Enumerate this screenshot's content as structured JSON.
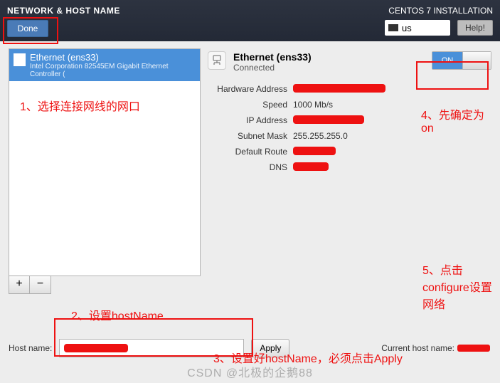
{
  "header": {
    "title": "NETWORK & HOST NAME",
    "done_label": "Done",
    "installer_title": "CENTOS 7 INSTALLATION",
    "keyboard_layout": "us",
    "help_label": "Help!"
  },
  "nic_list": {
    "items": [
      {
        "title": "Ethernet (ens33)",
        "subtitle": "Intel Corporation 82545EM Gigabit Ethernet Controller ("
      }
    ],
    "add_label": "+",
    "remove_label": "−"
  },
  "details": {
    "title": "Ethernet (ens33)",
    "status": "Connected",
    "rows": [
      {
        "label": "Hardware Address",
        "value": ""
      },
      {
        "label": "Speed",
        "value": "1000 Mb/s"
      },
      {
        "label": "IP Address",
        "value": ""
      },
      {
        "label": "Subnet Mask",
        "value": "255.255.255.0"
      },
      {
        "label": "Default Route",
        "value": ""
      },
      {
        "label": "DNS",
        "value": ""
      }
    ]
  },
  "toggle": {
    "on_label": "ON"
  },
  "hostname": {
    "label": "Host name:",
    "apply_label": "Apply",
    "current_label": "Current host name:"
  },
  "annotations": {
    "a1": "1、选择连接网线的网口",
    "a2": "2、设置hostName",
    "a3": "3、设置好hostName，必须点击Apply",
    "a4": "4、先确定为on",
    "a5": "5、点击configure设置网络"
  },
  "watermark": "CSDN @北极的企鹅88"
}
